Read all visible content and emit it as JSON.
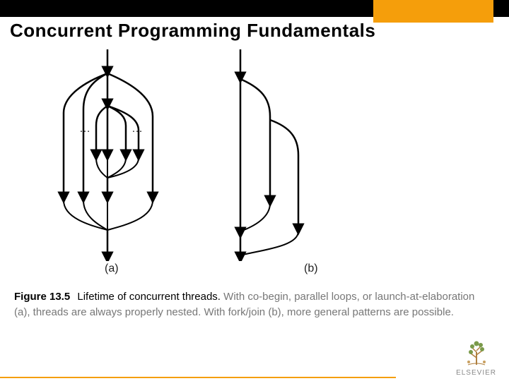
{
  "title": "Concurrent Programming Fundamentals",
  "figure": {
    "labels": {
      "a": "(a)",
      "b": "(b)"
    },
    "ellipsis_left": "…",
    "ellipsis_right": "…"
  },
  "caption": {
    "fignum": "Figure 13.5",
    "figtitle": "Lifetime of concurrent threads.",
    "body": " With co-begin, parallel loops, or launch-at-elaboration (a), threads are always properly nested. With fork/join (b), more general patterns are possible."
  },
  "brand": {
    "name": "ELSEVIER"
  }
}
